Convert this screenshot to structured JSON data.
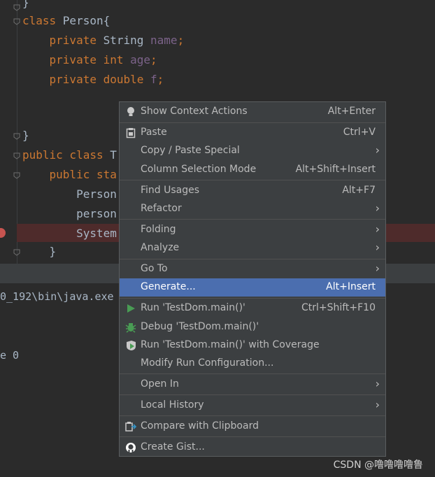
{
  "editor": {
    "lines": [
      {
        "parts": [
          {
            "t": "}",
            "c": ""
          }
        ]
      },
      {
        "parts": [
          {
            "t": "class ",
            "c": "kw"
          },
          {
            "t": "Person{",
            "c": ""
          }
        ]
      },
      {
        "parts": [
          {
            "t": "    private ",
            "c": "kw"
          },
          {
            "t": "String ",
            "c": ""
          },
          {
            "t": "name",
            "c": "fld"
          },
          {
            "t": ";",
            "c": "kw"
          }
        ]
      },
      {
        "parts": [
          {
            "t": "    private ",
            "c": "kw"
          },
          {
            "t": "int ",
            "c": "kw"
          },
          {
            "t": "age",
            "c": "fld"
          },
          {
            "t": ";",
            "c": "kw"
          }
        ]
      },
      {
        "parts": [
          {
            "t": "    private ",
            "c": "kw"
          },
          {
            "t": "double ",
            "c": "kw"
          },
          {
            "t": "f",
            "c": "fld"
          },
          {
            "t": ";",
            "c": "kw"
          }
        ]
      },
      {
        "parts": [
          {
            "t": "",
            "c": ""
          }
        ]
      },
      {
        "parts": [
          {
            "t": "",
            "c": ""
          }
        ]
      },
      {
        "parts": [
          {
            "t": "}",
            "c": ""
          }
        ]
      },
      {
        "parts": [
          {
            "t": "public class ",
            "c": "kw"
          },
          {
            "t": "T",
            "c": ""
          }
        ]
      },
      {
        "parts": [
          {
            "t": "    public sta",
            "c": "kw"
          }
        ]
      },
      {
        "parts": [
          {
            "t": "        Person",
            "c": ""
          }
        ]
      },
      {
        "parts": [
          {
            "t": "        person",
            "c": ""
          }
        ]
      },
      {
        "parts": [
          {
            "t": "        System",
            "c": ""
          }
        ]
      },
      {
        "parts": [
          {
            "t": "    }",
            "c": ""
          }
        ]
      }
    ]
  },
  "console": {
    "path_text": "0_192\\bin\\java.exe",
    "exit_text": "e 0"
  },
  "menu": {
    "items": [
      {
        "label": "Show Context Actions",
        "shortcut": "Alt+Enter",
        "submenu": false,
        "icon": "bulb-icon"
      },
      {
        "label": "Paste",
        "shortcut": "Ctrl+V",
        "submenu": false,
        "icon": "clipboard-icon"
      },
      {
        "label": "Copy / Paste Special",
        "shortcut": "",
        "submenu": true,
        "icon": ""
      },
      {
        "label": "Column Selection Mode",
        "shortcut": "Alt+Shift+Insert",
        "submenu": false,
        "icon": ""
      },
      {
        "label": "Find Usages",
        "shortcut": "Alt+F7",
        "submenu": false,
        "icon": ""
      },
      {
        "label": "Refactor",
        "shortcut": "",
        "submenu": true,
        "icon": ""
      },
      {
        "label": "Folding",
        "shortcut": "",
        "submenu": true,
        "icon": ""
      },
      {
        "label": "Analyze",
        "shortcut": "",
        "submenu": true,
        "icon": ""
      },
      {
        "label": "Go To",
        "shortcut": "",
        "submenu": true,
        "icon": ""
      },
      {
        "label": "Generate...",
        "shortcut": "Alt+Insert",
        "submenu": false,
        "icon": "",
        "selected": true
      },
      {
        "label": "Run 'TestDom.main()'",
        "shortcut": "Ctrl+Shift+F10",
        "submenu": false,
        "icon": "run-icon"
      },
      {
        "label": "Debug 'TestDom.main()'",
        "shortcut": "",
        "submenu": false,
        "icon": "debug-icon"
      },
      {
        "label": "Run 'TestDom.main()' with Coverage",
        "shortcut": "",
        "submenu": false,
        "icon": "coverage-icon"
      },
      {
        "label": "Modify Run Configuration...",
        "shortcut": "",
        "submenu": false,
        "icon": ""
      },
      {
        "label": "Open In",
        "shortcut": "",
        "submenu": true,
        "icon": ""
      },
      {
        "label": "Local History",
        "shortcut": "",
        "submenu": true,
        "icon": ""
      },
      {
        "label": "Compare with Clipboard",
        "shortcut": "",
        "submenu": false,
        "icon": "compare-icon"
      },
      {
        "label": "Create Gist...",
        "shortcut": "",
        "submenu": false,
        "icon": "github-icon"
      }
    ]
  },
  "watermark": "CSDN @噜噜噜噜鲁",
  "colors": {
    "selection": "#4b6eaf",
    "keyword": "#cc7832",
    "field": "#9876aa",
    "run": "#499c54"
  }
}
